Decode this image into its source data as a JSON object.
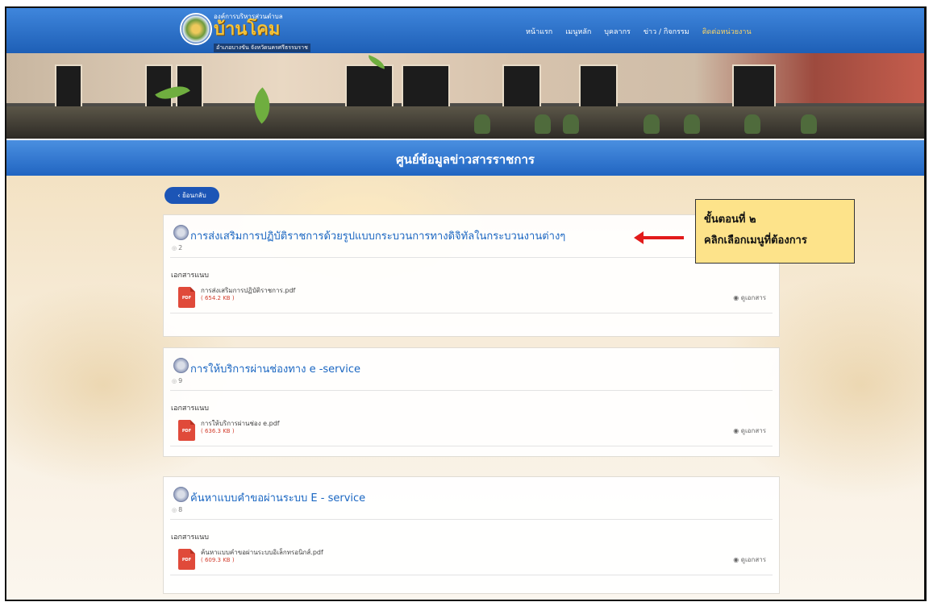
{
  "header": {
    "org_line": "องค์การบริหารส่วนตำบล",
    "org_name": "บ้านโคม",
    "address_line": "อำเภอบางขัน จังหวัดนครศรีธรรมราช",
    "nav": [
      "หน้าแรก",
      "เมนูหลัก",
      "บุคลากร",
      "ข่าว / กิจกรรม",
      "ติดต่อหน่วยงาน"
    ]
  },
  "page": {
    "title": "ศูนย์ข้อมูลข่าวสารราชการ",
    "back_label": "‹ ย้อนกลับ"
  },
  "cards": [
    {
      "title": "การส่งเสริมการปฏิบัติราชการด้วยรูปแบบกระบวนการทางดิจิทัลในกระบวนงานต่างๆ",
      "views": "2",
      "attachments_label": "เอกสารแนบ",
      "file_name": "การส่งเสริมการปฏิบัติราชการ.pdf",
      "file_size": "( 654.2 KB )",
      "view_label": "ดูเอกสาร"
    },
    {
      "title": "การให้บริการผ่านช่องทาง e -service",
      "views": "9",
      "attachments_label": "เอกสารแนบ",
      "file_name": "การให้บริการผ่านช่อง e.pdf",
      "file_size": "( 636.3 KB )",
      "view_label": "ดูเอกสาร"
    },
    {
      "title": "ค้นหาแบบคำขอผ่านระบบ E - service",
      "views": "8",
      "attachments_label": "เอกสารแนบ",
      "file_name": "ค้นหาแบบคำขอผ่านระบบอิเล็กทรอนิกส์.pdf",
      "file_size": "( 609.3 KB )",
      "view_label": "ดูเอกสาร"
    }
  ],
  "pdf_label": "PDF",
  "callout": {
    "line1": "ขั้นตอนที่ ๒",
    "line2": "คลิกเลือกเมนูที่ต้องการ"
  },
  "colors": {
    "header_blue": "#1e5fb6",
    "link_blue": "#1a66c2",
    "callout_yellow": "#fde38a",
    "arrow_red": "#e21b1b"
  }
}
